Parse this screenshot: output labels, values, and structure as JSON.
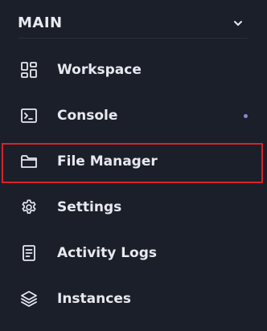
{
  "section": {
    "title": "MAIN",
    "collapse_icon": "chevron-down-icon"
  },
  "nav": {
    "items": [
      {
        "label": "Workspace",
        "icon": "workspace-grid-icon"
      },
      {
        "label": "Console",
        "icon": "terminal-icon",
        "indicator": true
      },
      {
        "label": "File Manager",
        "icon": "folder-icon",
        "highlighted": true
      },
      {
        "label": "Settings",
        "icon": "gear-icon"
      },
      {
        "label": "Activity Logs",
        "icon": "document-list-icon"
      },
      {
        "label": "Instances",
        "icon": "layers-icon"
      }
    ]
  },
  "colors": {
    "background": "#1b1f2a",
    "text": "#e7e9ee",
    "indicator_dot": "#8b85d6",
    "highlight_border": "#d6232a"
  }
}
